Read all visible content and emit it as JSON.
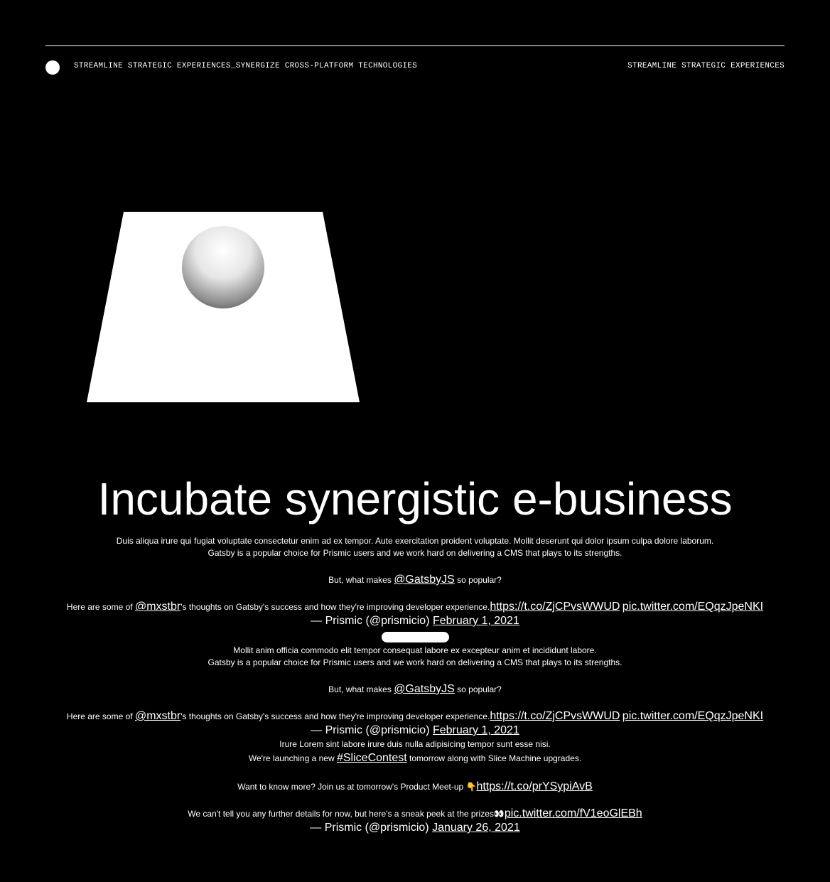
{
  "header": {
    "left_text": "STREAMLINE STRATEGIC EXPERIENCES_SYNERGIZE CROSS-PLATFORM TECHNOLOGIES",
    "right_text": "STREAMLINE STRATEGIC EXPERIENCES"
  },
  "hero": {
    "title": "Incubate synergistic e-business"
  },
  "blocks": [
    {
      "intro": "Duis aliqua irure qui fugiat voluptate consectetur enim ad ex tempor. Aute exercitation proident voluptate. Mollit deserunt qui dolor ipsum culpa dolore laborum.",
      "tweet_line1": "Gatsby is a popular choice for Prismic users and we work hard on delivering a CMS that plays to its strengths.",
      "tweet_q_pre": "But, what makes ",
      "tweet_q_mention": "@GatsbyJS",
      "tweet_q_post": " so popular?",
      "tweet_p_pre": "Here are some of ",
      "tweet_p_mention": "@mxstbr",
      "tweet_p_post": "'s thoughts on Gatsby's success and how they're improving developer experience.",
      "link1": "https://t.co/ZjCPvsWWUD",
      "link2": "pic.twitter.com/EQqzJpeNKI",
      "sig_text": "— Prismic (@prismicio) ",
      "sig_date": "February 1, 2021"
    },
    {
      "intro": "Mollit anim officia commodo elit tempor consequat labore ex excepteur anim et incididunt labore.",
      "tweet_line1": "Gatsby is a popular choice for Prismic users and we work hard on delivering a CMS that plays to its strengths.",
      "tweet_q_pre": "But, what makes ",
      "tweet_q_mention": "@GatsbyJS",
      "tweet_q_post": " so popular?",
      "tweet_p_pre": "Here are some of ",
      "tweet_p_mention": "@mxstbr",
      "tweet_p_post": "'s thoughts on Gatsby's success and how they're improving developer experience.",
      "link1": "https://t.co/ZjCPvsWWUD",
      "link2": "pic.twitter.com/EQqzJpeNKI",
      "sig_text": "— Prismic (@prismicio) ",
      "sig_date": "February 1, 2021"
    },
    {
      "intro": "Irure Lorem sint labore irure duis nulla adipisicing tempor sunt esse nisi.",
      "launch_pre": "We're launching a new ",
      "launch_tag": "#SliceContest",
      "launch_post": " tomorrow along with Slice Machine upgrades.",
      "meetup_text": "Want to know more? Join us at tomorrow's Product Meet-up 👇",
      "meetup_link": "https://t.co/prYSypiAvB",
      "peek_text": "We can't tell you any further details for now, but here's a sneak peek at the prizes👀",
      "peek_link": "pic.twitter.com/fV1eoGlEBh",
      "sig_text": "— Prismic (@prismicio) ",
      "sig_date": "January 26, 2021"
    }
  ]
}
